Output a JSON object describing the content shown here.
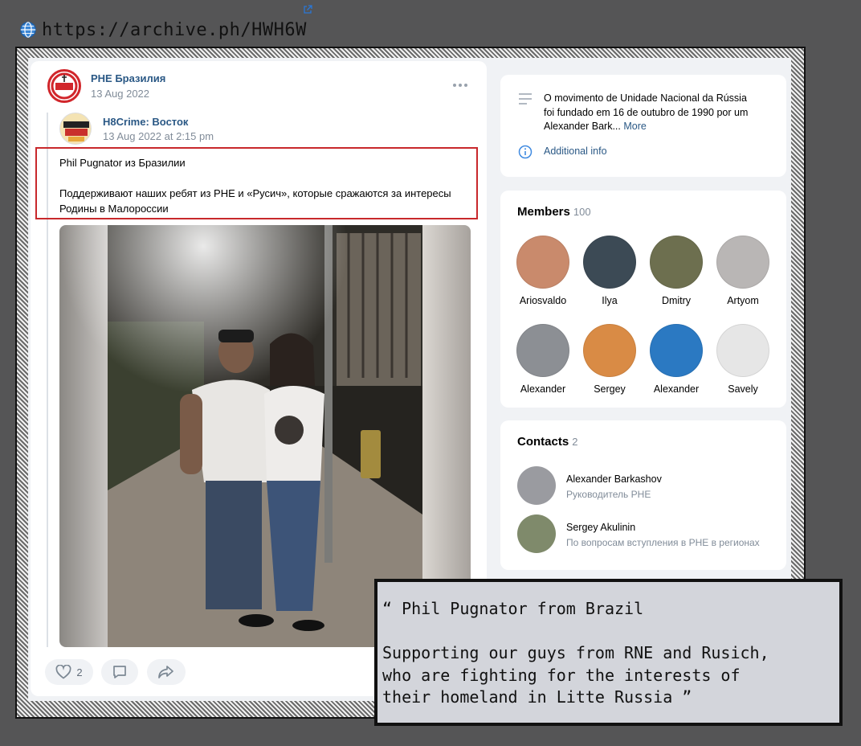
{
  "url_label": "https://archive.ph/HWH6W",
  "post": {
    "group_name": "РНЕ Бразилия",
    "group_date": "13 Aug 2022",
    "more_icon": "more-dots-icon",
    "repost": {
      "author": "H8Crime: Восток",
      "date": "13 Aug 2022 at 2:15 pm"
    },
    "text_line1": "Phil Pugnator из Бразилии",
    "text_line2": "Поддерживают наших ребят из РНЕ и «Русич», которые сражаются за интересы",
    "text_line3": "Родины в Малороссии",
    "likes": "2"
  },
  "about": {
    "description_line1": "O movimento de Unidade Nacional da Rússia",
    "description_line2": "foi fundado em 16 de outubro de 1990 por um",
    "description_line3": "Alexander Bark...",
    "more_label": "More",
    "additional_info": "Additional info"
  },
  "members": {
    "title": "Members",
    "count": "100",
    "list": [
      {
        "name": "Ariosvaldo",
        "color": "#c98a6c"
      },
      {
        "name": "Ilya",
        "color": "#3c4a55"
      },
      {
        "name": "Dmitry",
        "color": "#6d6f4f"
      },
      {
        "name": "Artyom",
        "color": "#b9b6b5"
      },
      {
        "name": "Alexander",
        "color": "#8c8f94"
      },
      {
        "name": "Sergey",
        "color": "#d98b45"
      },
      {
        "name": "Alexander",
        "color": "#2b79c2"
      },
      {
        "name": "Savely",
        "color": "#e6e6e6"
      }
    ]
  },
  "contacts": {
    "title": "Contacts",
    "count": "2",
    "list": [
      {
        "name": "Alexander Barkashov",
        "role": "Руководитель РНЕ",
        "color": "#9a9ba0"
      },
      {
        "name": "Sergey Akulinin",
        "role": "По вопросам вступления в РНЕ в регионах",
        "color": "#7f8a6b"
      }
    ]
  },
  "caption": {
    "line1": "“ Phil Pugnator from Brazil",
    "line2": "Supporting our guys from RNE and Rusich,",
    "line3": "who are fighting for the interests of",
    "line4": "their homeland in Litte Russia ”"
  },
  "colors": {
    "vk_link": "#2a5885",
    "highlight_border": "#c8282c",
    "page_bg": "#555556",
    "caption_bg": "#d3d5db"
  }
}
